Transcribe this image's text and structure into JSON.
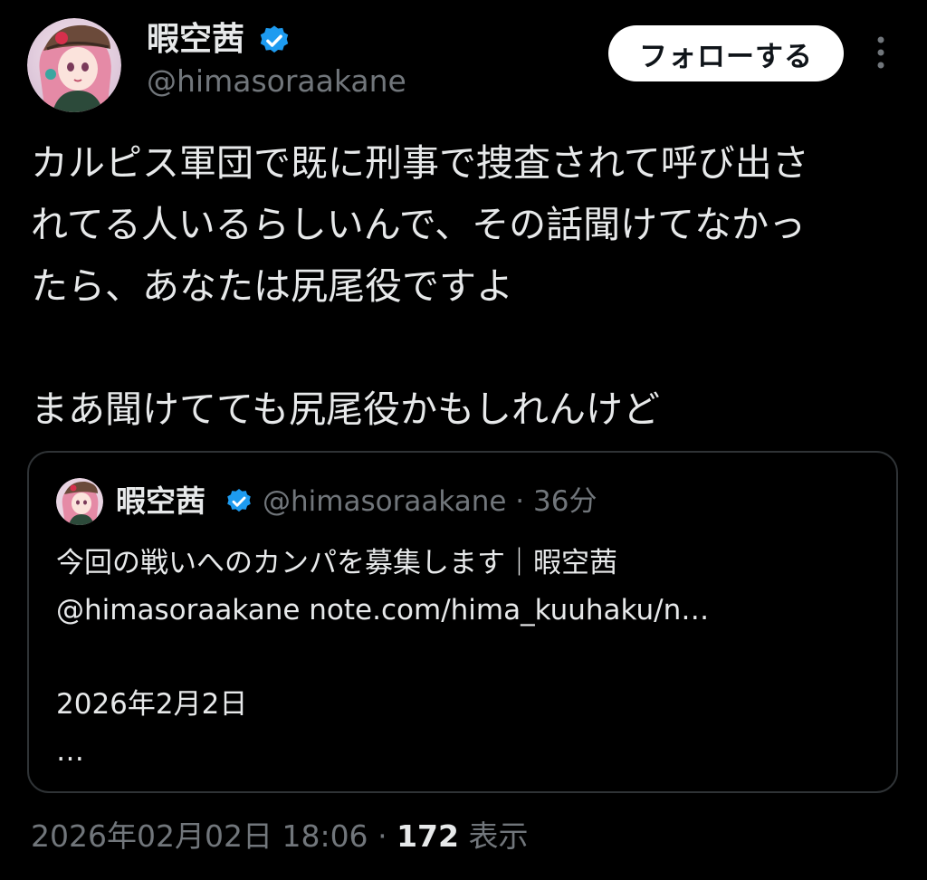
{
  "author": {
    "display_name": "暇空茜",
    "handle": "@himasoraakane",
    "avatar": "anime-girl-avatar",
    "verified": true,
    "verified_icon": "verified-badge-icon",
    "verified_color": "#1d9bf0"
  },
  "header": {
    "follow_label": "フォローする",
    "more_icon": "more-vertical-icon"
  },
  "tweet": {
    "lines": [
      "カルピス軍団で既に刑事で捜査されて呼び出さ",
      "れてる人いるらしいんで、その話聞けてなかっ",
      "たら、あなたは尻尾役ですよ"
    ],
    "second_paragraph": "まあ聞けてても尻尾役かもしれんけど"
  },
  "quote": {
    "display_name": "暇空茜",
    "handle": "@himasoraakane",
    "separator": "·",
    "time": "36分",
    "lines": [
      "今回の戦いへのカンパを募集します｜暇空茜",
      "@himasoraakane note.com/hima_kuuhaku/n…",
      "",
      "2026年2月2日",
      "…"
    ]
  },
  "footer": {
    "timestamp": "2026年02月02日 18:06",
    "separator": "·",
    "views_count": "172",
    "views_label": "表示"
  },
  "colors": {
    "background": "#000000",
    "text_primary": "#e7e9ea",
    "text_secondary": "#71767b",
    "border": "#2f3336",
    "accent": "#1d9bf0"
  }
}
